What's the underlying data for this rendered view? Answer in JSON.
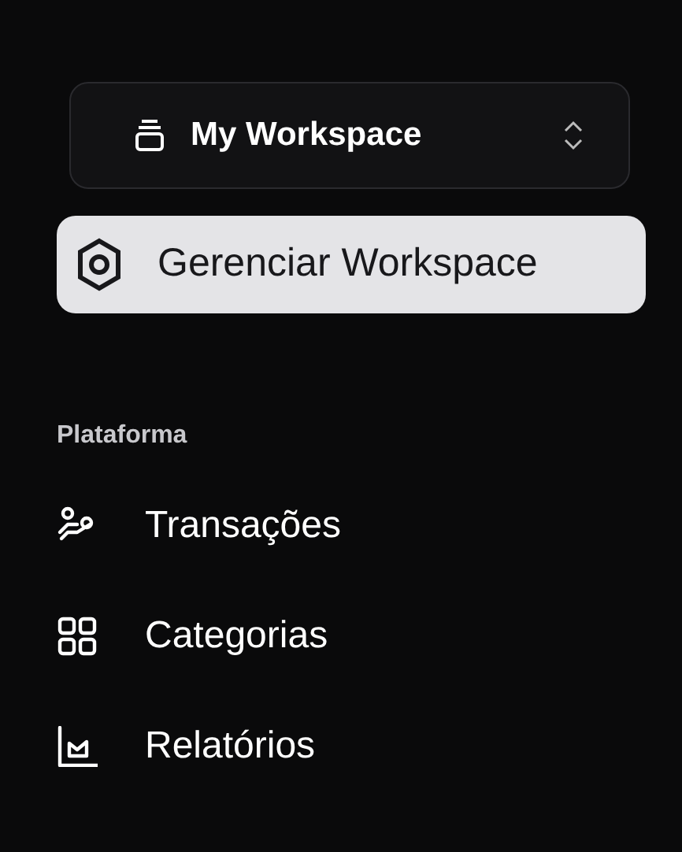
{
  "workspace_switcher": {
    "label": "My Workspace"
  },
  "manage_item": {
    "label": "Gerenciar Workspace",
    "selected": true
  },
  "section": {
    "title": "Plataforma",
    "items": [
      {
        "label": "Transações",
        "selected": false
      },
      {
        "label": "Categorias",
        "selected": false
      },
      {
        "label": "Relatórios",
        "selected": false
      }
    ]
  }
}
